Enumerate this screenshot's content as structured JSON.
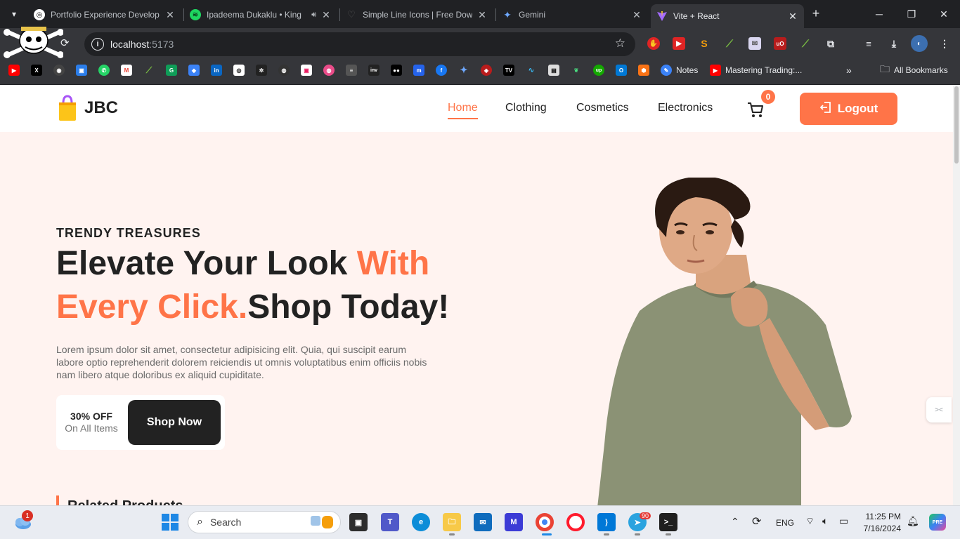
{
  "browser": {
    "tabs": [
      {
        "title": "Portfolio Experience Develop",
        "favicon": "openai-icon"
      },
      {
        "title": "Ipadeema Dukaklu • King",
        "favicon": "spotify-icon"
      },
      {
        "title": "Simple Line Icons | Free Dow",
        "favicon": "heart-icon"
      },
      {
        "title": "Gemini",
        "favicon": "gemini-icon"
      },
      {
        "title": "Vite + React",
        "favicon": "vite-icon"
      }
    ],
    "address": {
      "host": "localhost",
      "port": ":5173"
    },
    "bookmarks": {
      "notes": "Notes",
      "mastering": "Mastering Trading:...",
      "all": "All Bookmarks"
    }
  },
  "site": {
    "brand": "JBC",
    "nav": [
      "Home",
      "Clothing",
      "Cosmetics",
      "Electronics"
    ],
    "cart_count": "0",
    "logout": "Logout",
    "eyebrow": "TRENDY TREASURES",
    "headline": {
      "part1": "Elevate Your Look ",
      "accent1": "With",
      "accent2": "Every Click.",
      "part2": "Shop Today!"
    },
    "description": "Lorem ipsum dolor sit amet, consectetur adipisicing elit. Quia, qui suscipit earum labore optio reprehenderit dolorem reiciendis ut omnis voluptatibus enim officiis nobis nam libero atque doloribus ex aliquid cupiditate.",
    "offer": {
      "percent": "30% OFF",
      "sub": "On All Items"
    },
    "shop_button": "Shop Now",
    "related": "Related Products"
  },
  "taskbar": {
    "search_label": "Search",
    "weather_badge": "1",
    "telegram_badge": "90",
    "lang": "ENG",
    "time": "11:25 PM",
    "date": "7/16/2024"
  },
  "colors": {
    "accent": "#ff7448",
    "dark": "#222222",
    "hero_bg": "#fff3f0"
  }
}
